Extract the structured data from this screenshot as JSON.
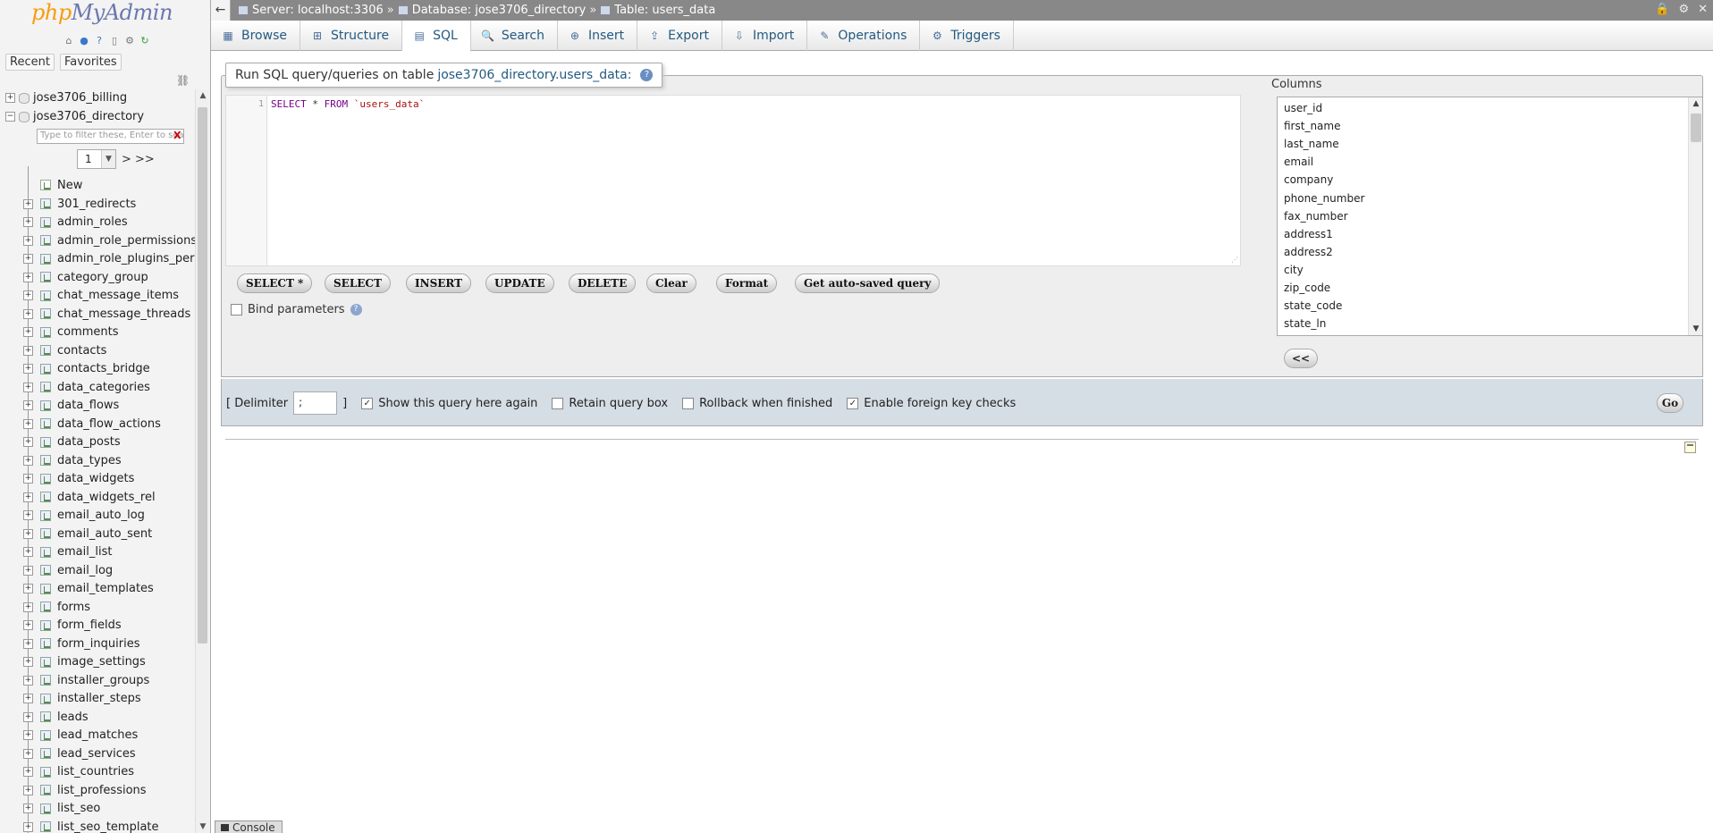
{
  "nav": {
    "logo_php": "php",
    "logo_myadmin": "MyAdmin",
    "tabs": [
      "Recent",
      "Favorites"
    ],
    "databases": [
      "jose3706_billing",
      "jose3706_directory"
    ],
    "filter_placeholder": "Type to filter these, Enter to search all",
    "filter_clear": "X",
    "page_value": "1",
    "page_next": "> >>",
    "new_label": "New",
    "tables": [
      "301_redirects",
      "admin_roles",
      "admin_role_permissions",
      "admin_role_plugins_permis",
      "category_group",
      "chat_message_items",
      "chat_message_threads",
      "comments",
      "contacts",
      "contacts_bridge",
      "data_categories",
      "data_flows",
      "data_flow_actions",
      "data_posts",
      "data_types",
      "data_widgets",
      "data_widgets_rel",
      "email_auto_log",
      "email_auto_sent",
      "email_list",
      "email_log",
      "email_templates",
      "forms",
      "form_fields",
      "form_inquiries",
      "image_settings",
      "installer_groups",
      "installer_steps",
      "leads",
      "lead_matches",
      "lead_services",
      "list_countries",
      "list_professions",
      "list_seo",
      "list_seo_template"
    ]
  },
  "topbar": {
    "back": "←",
    "server": "Server: localhost:3306",
    "database": "Database: jose3706_directory",
    "table": "Table: users_data",
    "sep": "»"
  },
  "tabs": [
    {
      "label": "Browse",
      "icon": "▦"
    },
    {
      "label": "Structure",
      "icon": "⊞"
    },
    {
      "label": "SQL",
      "icon": "▤"
    },
    {
      "label": "Search",
      "icon": "🔍"
    },
    {
      "label": "Insert",
      "icon": "⊕"
    },
    {
      "label": "Export",
      "icon": "⇪"
    },
    {
      "label": "Import",
      "icon": "⇩"
    },
    {
      "label": "Operations",
      "icon": "✎"
    },
    {
      "label": "Triggers",
      "icon": "⚙"
    }
  ],
  "sql": {
    "legend_prefix": "Run SQL query/queries on table",
    "legend_table": "jose3706_directory.users_data:",
    "line_number": "1",
    "query_kw1": "SELECT",
    "query_star": " * ",
    "query_kw2": "FROM",
    "query_table": " `users_data`",
    "buttons": [
      "SELECT *",
      "SELECT",
      "INSERT",
      "UPDATE",
      "DELETE",
      "Clear",
      "Format",
      "Get auto-saved query"
    ],
    "bind_params": "Bind parameters"
  },
  "columns": {
    "label": "Columns",
    "items": [
      "user_id",
      "first_name",
      "last_name",
      "email",
      "company",
      "phone_number",
      "fax_number",
      "address1",
      "address2",
      "city",
      "zip_code",
      "state_code",
      "state_ln"
    ],
    "insert_button": "<<"
  },
  "options": {
    "delimiter_open": "[ Delimiter",
    "delimiter_value": ";",
    "delimiter_close": "]",
    "show_query": "Show this query here again",
    "retain_box": "Retain query box",
    "rollback": "Rollback when finished",
    "fk_checks": "Enable foreign key checks",
    "go": "Go"
  },
  "console": {
    "label": "Console"
  }
}
